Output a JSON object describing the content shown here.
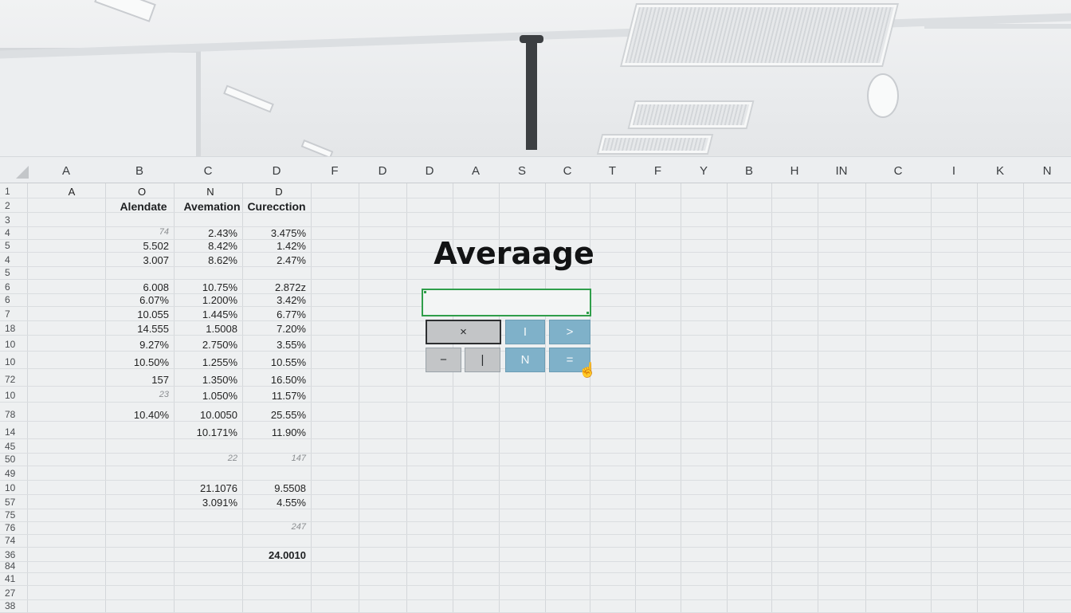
{
  "columns": [
    "A",
    "B",
    "C",
    "D",
    "F",
    "D",
    "D",
    "A",
    "S",
    "C",
    "T",
    "F",
    "Y",
    "B",
    "H",
    "IN",
    "C",
    "I",
    "K",
    "N"
  ],
  "rows": [
    {
      "num": "1",
      "b": "O",
      "c": "N",
      "d": "D",
      "a": "A",
      "kind": "letters"
    },
    {
      "num": "2",
      "b": "Alendate",
      "c": "Avemation",
      "d": "Curecction",
      "kind": "header"
    },
    {
      "num": "3",
      "b": "",
      "c": "",
      "d": ""
    },
    {
      "num": "4",
      "b": "74",
      "c": "2.43%",
      "d": "3.475%",
      "bfaint": true
    },
    {
      "num": "5",
      "b": "5.502",
      "c": "8.42%",
      "d": "1.42%"
    },
    {
      "num": "4",
      "b": "3.007",
      "c": "8.62%",
      "d": "2.47%"
    },
    {
      "num": "5",
      "b": "",
      "c": "",
      "d": ""
    },
    {
      "num": "6",
      "b": "6.008",
      "c": "10.75%",
      "d": "2.872z"
    },
    {
      "num": "6",
      "b": "6.07%",
      "c": "1.200%",
      "d": "3.42%"
    },
    {
      "num": "7",
      "b": "10.055",
      "c": "1.445%",
      "d": "6.77%"
    },
    {
      "num": "18",
      "b": "14.555",
      "c": "1.5008",
      "d": "7.20%"
    },
    {
      "num": "10",
      "b": "9.27%",
      "c": "2.750%",
      "d": "3.55%"
    },
    {
      "num": "10",
      "b": "10.50%",
      "c": "1.255%",
      "d": "10.55%"
    },
    {
      "num": "72",
      "b": "157",
      "c": "1.350%",
      "d": "16.50%"
    },
    {
      "num": "10",
      "b": "23",
      "c": "1.050%",
      "d": "11.57%",
      "bfaint": true
    },
    {
      "num": "78",
      "b": "10.40%",
      "c": "10.0050",
      "d": "25.55%"
    },
    {
      "num": "14",
      "b": "",
      "c": "10.171%",
      "d": "11.90%"
    },
    {
      "num": "45",
      "b": "",
      "c": "",
      "d": ""
    },
    {
      "num": "50",
      "b": "",
      "c": "22",
      "d": "147",
      "cfaint": true,
      "dfaint": true
    },
    {
      "num": "49",
      "b": "",
      "c": "",
      "d": ""
    },
    {
      "num": "10",
      "b": "",
      "c": "21.1076",
      "d": "9.5508"
    },
    {
      "num": "57",
      "b": "",
      "c": "3.091%",
      "d": "4.55%"
    },
    {
      "num": "75",
      "b": "",
      "c": "",
      "d": ""
    },
    {
      "num": "76",
      "b": "",
      "c": "",
      "d": "247",
      "dfaint": true
    },
    {
      "num": "74",
      "b": "",
      "c": "",
      "d": ""
    },
    {
      "num": "36",
      "b": "",
      "c": "",
      "d": "24.0010",
      "dbold": true
    },
    {
      "num": "84",
      "b": "",
      "c": "",
      "d": ""
    },
    {
      "num": "41",
      "b": "",
      "c": "",
      "d": ""
    },
    {
      "num": "27",
      "b": "",
      "c": "",
      "d": ""
    },
    {
      "num": "38",
      "b": "",
      "c": "",
      "d": ""
    }
  ],
  "widget": {
    "title": "Averaage",
    "formula_value": "",
    "buttons": [
      {
        "label": "×",
        "style": "gray-selected"
      },
      {
        "label": "I",
        "style": "blue"
      },
      {
        "label": ">",
        "style": "blue"
      },
      {
        "label": "−",
        "style": "gray"
      },
      {
        "label": "|",
        "style": "gray"
      },
      {
        "label": "N",
        "style": "blue"
      },
      {
        "label": "=",
        "style": "blue"
      }
    ]
  },
  "colors": {
    "accent_green": "#2f9e4a",
    "button_blue": "#7fb1c9",
    "button_gray": "#c3c5c7"
  }
}
